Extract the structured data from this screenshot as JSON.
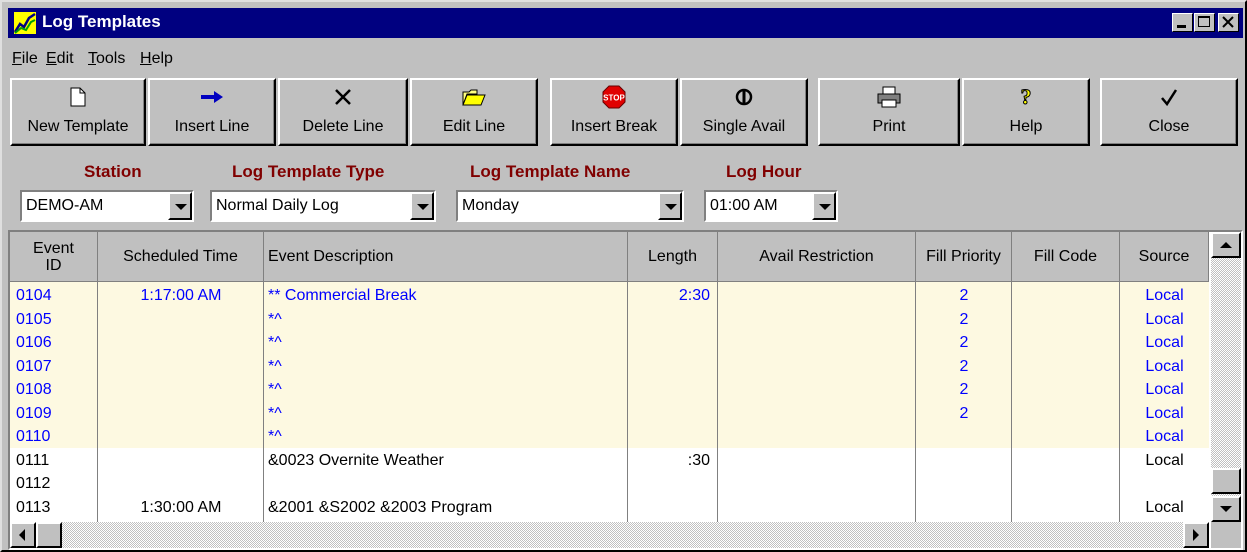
{
  "window": {
    "title": "Log Templates",
    "title_bar_color": "#000080"
  },
  "menu": [
    {
      "label": "File",
      "accel": "F"
    },
    {
      "label": "Edit",
      "accel": "E"
    },
    {
      "label": "Tools",
      "accel": "T"
    },
    {
      "label": "Help",
      "accel": "H"
    }
  ],
  "toolbar": {
    "new_template": "New Template",
    "insert_line": "Insert Line",
    "delete_line": "Delete Line",
    "edit_line": "Edit Line",
    "insert_break": "Insert Break",
    "single_avail": "Single Avail",
    "print": "Print",
    "help": "Help",
    "close": "Close"
  },
  "selectors": {
    "station": {
      "label": "Station",
      "value": "DEMO-AM"
    },
    "type": {
      "label": "Log Template Type",
      "value": "Normal Daily Log"
    },
    "name": {
      "label": "Log Template Name",
      "value": "Monday"
    },
    "hour": {
      "label": "Log Hour",
      "value": "01:00 AM"
    }
  },
  "label_color": "#800000",
  "grid": {
    "columns": {
      "event_id": "Event ID",
      "scheduled_time": "Scheduled Time",
      "description": "Event Description",
      "length": "Length",
      "avail_restriction": "Avail Restriction",
      "fill_priority": "Fill Priority",
      "fill_code": "Fill Code",
      "source": "Source"
    },
    "highlight_color": "#fdf9e1",
    "rows": [
      {
        "id": "0104",
        "time": "1:17:00 AM",
        "desc": "** Commercial Break",
        "length": "2:30",
        "restriction": "",
        "priority": "2",
        "fill_code": "",
        "source": "Local",
        "blue": true
      },
      {
        "id": "0105",
        "time": "",
        "desc": "*^",
        "length": "",
        "restriction": "",
        "priority": "2",
        "fill_code": "",
        "source": "Local",
        "blue": true
      },
      {
        "id": "0106",
        "time": "",
        "desc": "*^",
        "length": "",
        "restriction": "",
        "priority": "2",
        "fill_code": "",
        "source": "Local",
        "blue": true
      },
      {
        "id": "0107",
        "time": "",
        "desc": "*^",
        "length": "",
        "restriction": "",
        "priority": "2",
        "fill_code": "",
        "source": "Local",
        "blue": true
      },
      {
        "id": "0108",
        "time": "",
        "desc": "*^",
        "length": "",
        "restriction": "",
        "priority": "2",
        "fill_code": "",
        "source": "Local",
        "blue": true
      },
      {
        "id": "0109",
        "time": "",
        "desc": "*^",
        "length": "",
        "restriction": "",
        "priority": "2",
        "fill_code": "",
        "source": "Local",
        "blue": true
      },
      {
        "id": "0110",
        "time": "",
        "desc": "*^",
        "length": "",
        "restriction": "",
        "priority": "",
        "fill_code": "",
        "source": "Local",
        "blue": true
      },
      {
        "id": "0111",
        "time": "",
        "desc": "&0023  Overnite Weather",
        "length": ":30",
        "restriction": "",
        "priority": "",
        "fill_code": "",
        "source": "Local",
        "blue": false
      },
      {
        "id": "0112",
        "time": "",
        "desc": "",
        "length": "",
        "restriction": "",
        "priority": "",
        "fill_code": "",
        "source": "",
        "blue": false
      },
      {
        "id": "0113",
        "time": "1:30:00 AM",
        "desc": "&2001  &S2002  &2003  Program",
        "length": "",
        "restriction": "",
        "priority": "",
        "fill_code": "",
        "source": "Local",
        "blue": false
      }
    ]
  }
}
